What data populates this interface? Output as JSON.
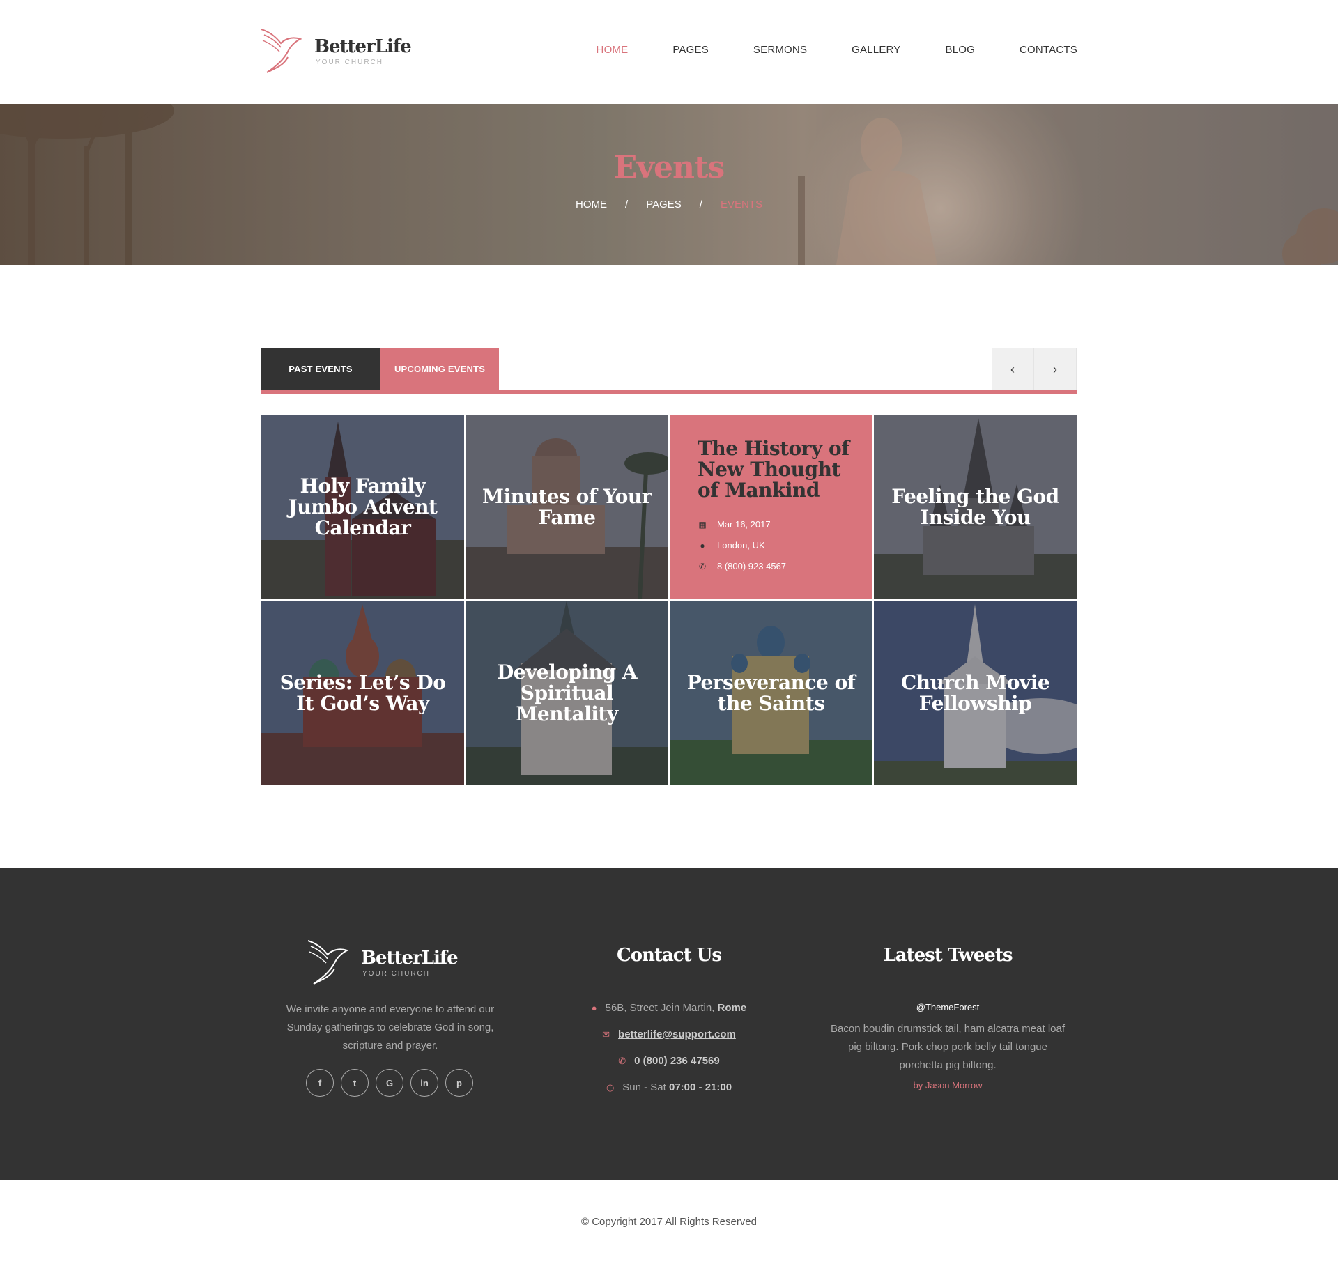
{
  "header": {
    "brand": "BetterLife",
    "tagline": "YOUR CHURCH",
    "nav": [
      "HOME",
      "PAGES",
      "SERMONS",
      "GALLERY",
      "BLOG",
      "CONTACTS"
    ],
    "active": "HOME"
  },
  "hero": {
    "title": "Events",
    "breadcrumb": [
      "HOME",
      "PAGES",
      "EVENTS"
    ],
    "separator": "/"
  },
  "tabs": {
    "past": "PAST EVENTS",
    "upcoming": "UPCOMING EVENTS",
    "prev_icon": "chevron-left-icon",
    "next_icon": "chevron-right-icon",
    "prev_glyph": "‹",
    "next_glyph": "›"
  },
  "events": [
    {
      "title": "Holy Family Jumbo Advent Calendar"
    },
    {
      "title": "Minutes of Your Fame"
    },
    {
      "title": "The History of New Thought of Mankind",
      "date": "Mar 16, 2017",
      "location": "London, UK",
      "phone": "8 (800) 923 4567"
    },
    {
      "title": "Feeling the God Inside You"
    },
    {
      "title": "Series: Let’s Do It God’s Way"
    },
    {
      "title": "Developing A Spiritual Mentality"
    },
    {
      "title": "Perseverance of the Saints"
    },
    {
      "title": "Church Movie Fellowship"
    }
  ],
  "footer": {
    "brand": "BetterLife",
    "tagline": "YOUR CHURCH",
    "about": "We invite anyone and everyone to attend our Sunday gatherings to celebrate God in song, scripture and prayer.",
    "socials": [
      {
        "icon": "facebook-icon",
        "glyph": "f"
      },
      {
        "icon": "twitter-icon",
        "glyph": "t"
      },
      {
        "icon": "google-icon",
        "glyph": "G"
      },
      {
        "icon": "linkedin-icon",
        "glyph": "in"
      },
      {
        "icon": "pinterest-icon",
        "glyph": "p"
      }
    ],
    "contact": {
      "heading": "Contact Us",
      "address": "56B, Street Jein Martin,",
      "city": "Rome",
      "email": "betterlife@support.com",
      "phone": "0 (800) 236 47569",
      "hours_label": "Sun - Sat",
      "hours": "07:00 - 21:00"
    },
    "tweets": {
      "heading": "Latest Tweets",
      "handle": "@ThemeForest",
      "text": "Bacon boudin drumstick tail, ham alcatra meat loaf pig biltong. Pork chop pork belly tail tongue porchetta pig biltong.",
      "author": "by Jason Morrow"
    }
  },
  "copyright": "© Copyright 2017 All Rights Reserved",
  "colors": {
    "accent": "#d9747c",
    "dark": "#333333",
    "footer_bg": "#333333"
  }
}
